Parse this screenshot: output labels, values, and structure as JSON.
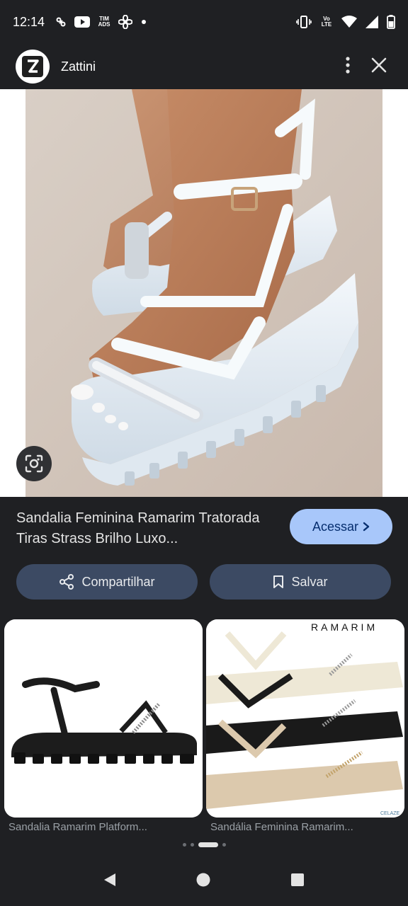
{
  "status_bar": {
    "time": "12:14",
    "tim_ads_label": "TIM ADS",
    "volte_label": "Vo LTE",
    "icons": [
      "link-icon",
      "youtube-icon",
      "tim-ads-icon",
      "fan-icon",
      "dot-icon",
      "vibrate-icon",
      "volte-icon",
      "wifi-icon",
      "signal-icon",
      "battery-icon"
    ]
  },
  "header": {
    "logo_letter": "Z",
    "site_name": "Zattini",
    "icons": [
      "more-vert-icon",
      "close-icon"
    ]
  },
  "product": {
    "title": "Sandalia Feminina Ramarim Tratorada Tiras Strass Brilho Luxo...",
    "visit_label": "Acessar"
  },
  "actions": {
    "share_label": "Compartilhar",
    "save_label": "Salvar"
  },
  "related": [
    {
      "caption": "Sandalia Ramarim Platform..."
    },
    {
      "caption": "Sandália Feminina Ramarim...",
      "brand": "RAMARIM",
      "corner_mark": "CELAZE"
    }
  ],
  "colors": {
    "background": "#1f2023",
    "accent_button": "#a8c7fa",
    "secondary_button": "#3c4a63"
  }
}
